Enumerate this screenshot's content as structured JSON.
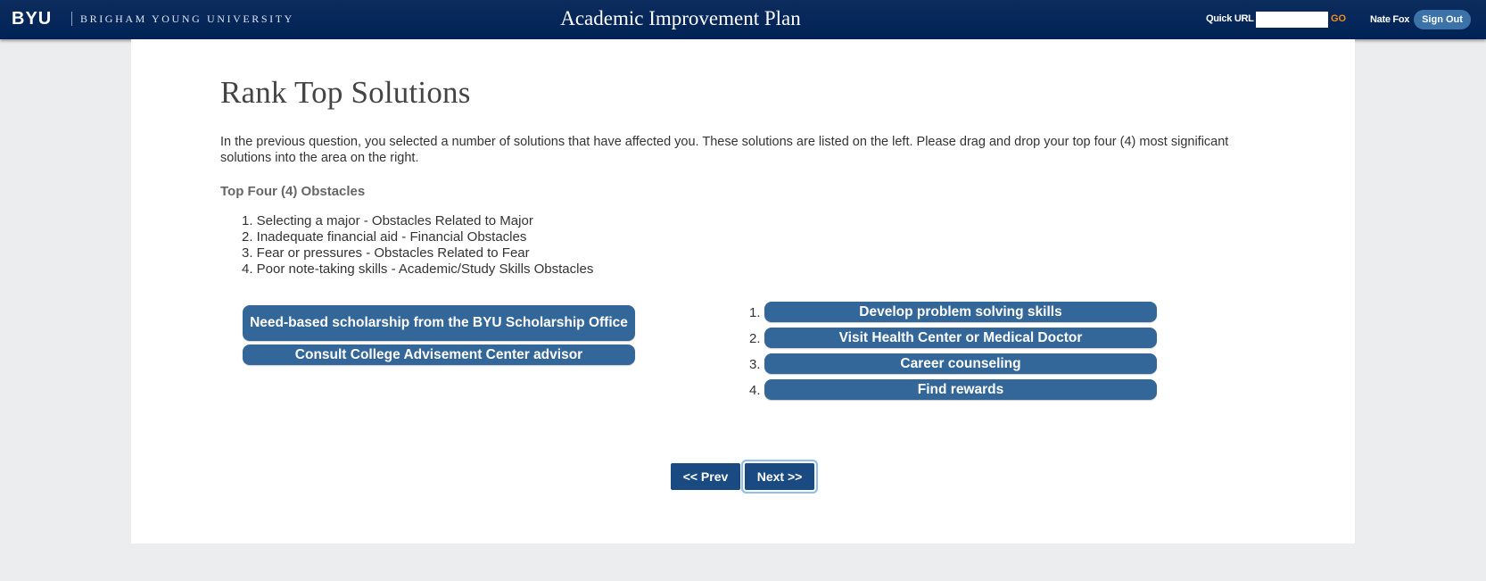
{
  "header": {
    "logo": "BYU",
    "university": "BRIGHAM YOUNG UNIVERSITY",
    "app_title": "Academic Improvement Plan",
    "quick_url_label": "Quick URL",
    "quick_url_value": "",
    "go_label": "GO",
    "user_name": "Nate Fox",
    "sign_out_label": "Sign Out"
  },
  "page": {
    "title": "Rank Top Solutions",
    "intro": "In the previous question, you selected a number of solutions that have affected you. These solutions are listed on the left. Please drag and drop your top four (4) most significant solutions into the area on the right.",
    "obstacles_heading": "Top Four (4) Obstacles",
    "obstacles": [
      "1. Selecting a major - Obstacles Related to Major",
      "2. Inadequate financial aid - Financial Obstacles",
      "3. Fear or pressures - Obstacles Related to Fear",
      "4. Poor note-taking skills - Academic/Study Skills Obstacles"
    ]
  },
  "available_solutions": [
    "Need-based scholarship from the BYU Scholarship Office",
    "Consult College Advisement Center advisor"
  ],
  "ranked_solutions": [
    {
      "rank": "1.",
      "label": "Develop problem solving skills"
    },
    {
      "rank": "2.",
      "label": "Visit Health Center or Medical Doctor"
    },
    {
      "rank": "3.",
      "label": "Career counseling"
    },
    {
      "rank": "4.",
      "label": "Find rewards"
    }
  ],
  "navigation": {
    "prev_label": "<< Prev",
    "next_label": "Next >>"
  },
  "colors": {
    "header_bg": "#002255",
    "pill_bg": "#336699",
    "nav_button_bg": "#1a4a82",
    "go_accent": "#f08c1e"
  }
}
